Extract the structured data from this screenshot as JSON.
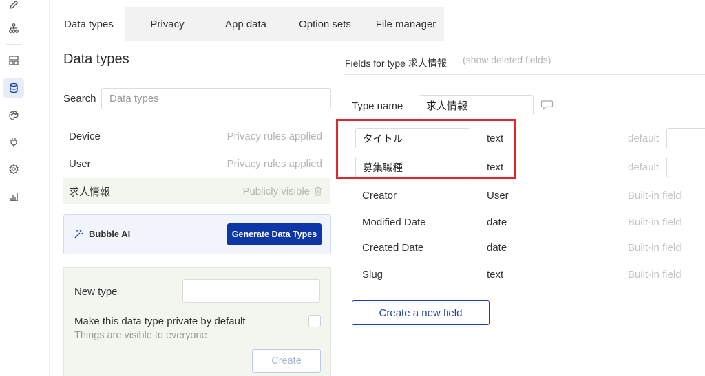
{
  "tabs": [
    {
      "label": "Data types",
      "active": true
    },
    {
      "label": "Privacy"
    },
    {
      "label": "App data"
    },
    {
      "label": "Option sets"
    },
    {
      "label": "File manager"
    }
  ],
  "left": {
    "title": "Data types",
    "search": {
      "label": "Search",
      "placeholder": "Data types",
      "value": ""
    },
    "types": [
      {
        "name": "Device",
        "status": "Privacy rules applied"
      },
      {
        "name": "User",
        "status": "Privacy rules applied"
      },
      {
        "name": "求人情報",
        "status": "Publicly visible",
        "selected": true
      }
    ],
    "ai": {
      "label": "Bubble AI",
      "button": "Generate Data Types"
    },
    "new_type": {
      "label": "New type",
      "value": "",
      "private_label": "Make this data type private by default",
      "private_hint": "Things are visible to everyone",
      "private_checked": false,
      "create_label": "Create"
    }
  },
  "right": {
    "title": "Fields for type 求人情報",
    "show_deleted": "(show deleted fields)",
    "type_name_label": "Type name",
    "type_name_value": "求人情報",
    "custom_fields": [
      {
        "name": "タイトル",
        "type": "text",
        "meta": "default"
      },
      {
        "name": "募集職種",
        "type": "text",
        "meta": "default"
      }
    ],
    "builtin_fields": [
      {
        "name": "Creator",
        "type": "User",
        "meta": "Built-in field"
      },
      {
        "name": "Modified Date",
        "type": "date",
        "meta": "Built-in field"
      },
      {
        "name": "Created Date",
        "type": "date",
        "meta": "Built-in field"
      },
      {
        "name": "Slug",
        "type": "text",
        "meta": "Built-in field"
      }
    ],
    "new_field_label": "Create a new field"
  },
  "colors": {
    "accent": "#0d36a6",
    "highlight": "#e0272d",
    "selected_row": "#f2f6ef"
  },
  "icons": [
    "pencil-icon",
    "workflow-icon",
    "design-icon",
    "database-icon",
    "palette-icon",
    "plugin-icon",
    "settings-icon",
    "logs-icon",
    "magic-wand-icon",
    "trash-icon",
    "comment-icon"
  ]
}
